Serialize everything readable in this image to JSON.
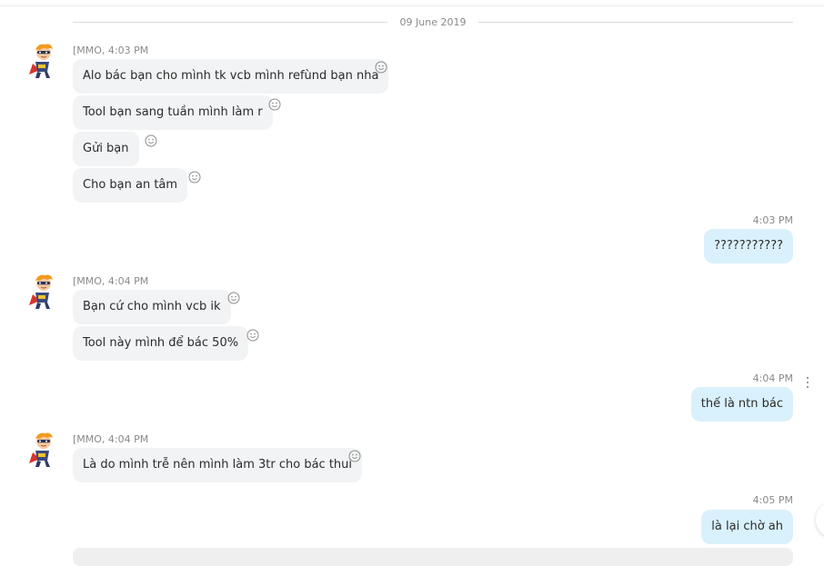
{
  "date_divider": "09 June 2019",
  "groups": [
    {
      "sender": "[MMO, 4:03 PM",
      "messages": [
        "Alo bác bạn cho mình tk vcb mình refùnd bạn nha",
        "Tool bạn sang tuần mình làm r",
        "Gửi bạn",
        "Cho bạn an tâm"
      ]
    },
    {
      "time": "4:03 PM",
      "messages": [
        "???????????"
      ]
    },
    {
      "sender": "[MMO, 4:04 PM",
      "messages": [
        "Bạn cứ cho mình vcb ik",
        "Tool này mình để bác 50%"
      ]
    },
    {
      "time": "4:04 PM",
      "messages": [
        "thế là ntn bác"
      ]
    },
    {
      "sender": "[MMO, 4:04 PM",
      "messages": [
        "Là do mình trễ nên mình làm 3tr cho bác thui"
      ]
    },
    {
      "time": "4:05 PM",
      "messages": [
        "là lại chờ ah"
      ]
    }
  ],
  "icons": {
    "avatar": "superhero-avatar-icon",
    "reaction": "smiley-reaction-icon",
    "more": "more-options-icon"
  },
  "colors": {
    "incoming_bubble": "#f1f3f5",
    "outgoing_bubble": "#d9f1fc",
    "meta_text": "#8a8a8a"
  }
}
